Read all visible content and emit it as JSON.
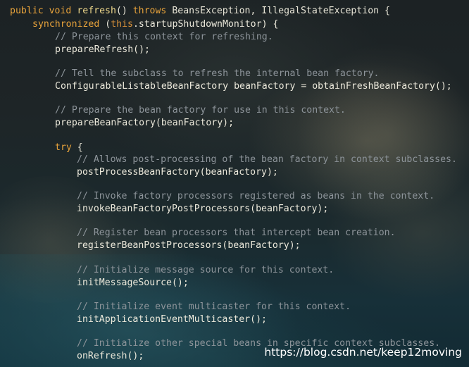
{
  "code": {
    "l1": {
      "public": "public",
      "void": "void",
      "method": "refresh",
      "params": "()",
      "throws": "throws",
      "exceptions": "BeansException, IllegalStateException {"
    },
    "l2": {
      "synchronized": "synchronized",
      "open": "(",
      "this": "this",
      "rest": ".startupShutdownMonitor) {"
    },
    "c1": "// Prepare this context for refreshing.",
    "s1": "prepareRefresh();",
    "c2": "// Tell the subclass to refresh the internal bean factory.",
    "s2": "ConfigurableListableBeanFactory beanFactory = obtainFreshBeanFactory();",
    "c3": "// Prepare the bean factory for use in this context.",
    "s3": "prepareBeanFactory(beanFactory);",
    "try": "try",
    "try_brace": "{",
    "c4": "// Allows post-processing of the bean factory in context subclasses.",
    "s4": "postProcessBeanFactory(beanFactory);",
    "c5": "// Invoke factory processors registered as beans in the context.",
    "s5": "invokeBeanFactoryPostProcessors(beanFactory);",
    "c6": "// Register bean processors that intercept bean creation.",
    "s6": "registerBeanPostProcessors(beanFactory);",
    "c7": "// Initialize message source for this context.",
    "s7": "initMessageSource();",
    "c8": "// Initialize event multicaster for this context.",
    "s8": "initApplicationEventMulticaster();",
    "c9": "// Initialize other special beans in specific context subclasses.",
    "s9": "onRefresh();"
  },
  "watermark": "https://blog.csdn.net/keep12moving",
  "colors": {
    "keyword": "#e8a33b",
    "method_name": "#f0d98c",
    "plain_text": "#ece9db",
    "comment": "#8d949a",
    "watermark": "#ffffff"
  }
}
